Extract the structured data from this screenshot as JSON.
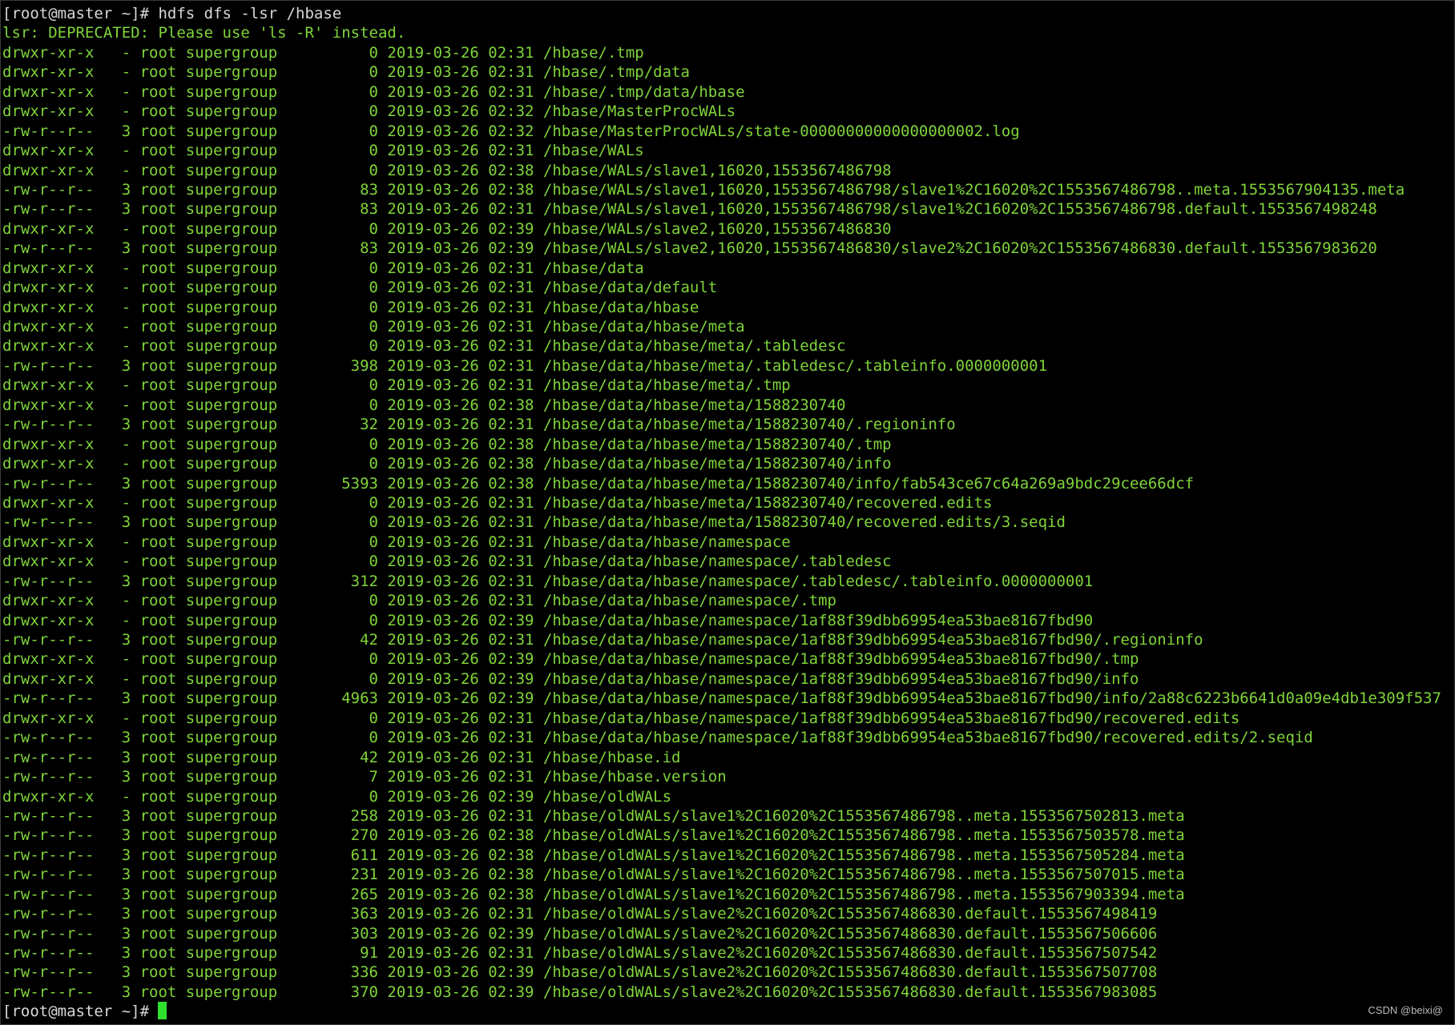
{
  "terminal": {
    "command_line": "[root@master ~]# hdfs dfs -lsr /hbase",
    "warning": "lsr: DEPRECATED: Please use 'ls -R' instead.",
    "listing": [
      "drwxr-xr-x   - root supergroup          0 2019-03-26 02:31 /hbase/.tmp",
      "drwxr-xr-x   - root supergroup          0 2019-03-26 02:31 /hbase/.tmp/data",
      "drwxr-xr-x   - root supergroup          0 2019-03-26 02:31 /hbase/.tmp/data/hbase",
      "drwxr-xr-x   - root supergroup          0 2019-03-26 02:32 /hbase/MasterProcWALs",
      "-rw-r--r--   3 root supergroup          0 2019-03-26 02:32 /hbase/MasterProcWALs/state-00000000000000000002.log",
      "drwxr-xr-x   - root supergroup          0 2019-03-26 02:31 /hbase/WALs",
      "drwxr-xr-x   - root supergroup          0 2019-03-26 02:38 /hbase/WALs/slave1,16020,1553567486798",
      "-rw-r--r--   3 root supergroup         83 2019-03-26 02:38 /hbase/WALs/slave1,16020,1553567486798/slave1%2C16020%2C1553567486798..meta.1553567904135.meta",
      "-rw-r--r--   3 root supergroup         83 2019-03-26 02:31 /hbase/WALs/slave1,16020,1553567486798/slave1%2C16020%2C1553567486798.default.1553567498248",
      "drwxr-xr-x   - root supergroup          0 2019-03-26 02:39 /hbase/WALs/slave2,16020,1553567486830",
      "-rw-r--r--   3 root supergroup         83 2019-03-26 02:39 /hbase/WALs/slave2,16020,1553567486830/slave2%2C16020%2C1553567486830.default.1553567983620",
      "drwxr-xr-x   - root supergroup          0 2019-03-26 02:31 /hbase/data",
      "drwxr-xr-x   - root supergroup          0 2019-03-26 02:31 /hbase/data/default",
      "drwxr-xr-x   - root supergroup          0 2019-03-26 02:31 /hbase/data/hbase",
      "drwxr-xr-x   - root supergroup          0 2019-03-26 02:31 /hbase/data/hbase/meta",
      "drwxr-xr-x   - root supergroup          0 2019-03-26 02:31 /hbase/data/hbase/meta/.tabledesc",
      "-rw-r--r--   3 root supergroup        398 2019-03-26 02:31 /hbase/data/hbase/meta/.tabledesc/.tableinfo.0000000001",
      "drwxr-xr-x   - root supergroup          0 2019-03-26 02:31 /hbase/data/hbase/meta/.tmp",
      "drwxr-xr-x   - root supergroup          0 2019-03-26 02:38 /hbase/data/hbase/meta/1588230740",
      "-rw-r--r--   3 root supergroup         32 2019-03-26 02:31 /hbase/data/hbase/meta/1588230740/.regioninfo",
      "drwxr-xr-x   - root supergroup          0 2019-03-26 02:38 /hbase/data/hbase/meta/1588230740/.tmp",
      "drwxr-xr-x   - root supergroup          0 2019-03-26 02:38 /hbase/data/hbase/meta/1588230740/info",
      "-rw-r--r--   3 root supergroup       5393 2019-03-26 02:38 /hbase/data/hbase/meta/1588230740/info/fab543ce67c64a269a9bdc29cee66dcf",
      "drwxr-xr-x   - root supergroup          0 2019-03-26 02:31 /hbase/data/hbase/meta/1588230740/recovered.edits",
      "-rw-r--r--   3 root supergroup          0 2019-03-26 02:31 /hbase/data/hbase/meta/1588230740/recovered.edits/3.seqid",
      "drwxr-xr-x   - root supergroup          0 2019-03-26 02:31 /hbase/data/hbase/namespace",
      "drwxr-xr-x   - root supergroup          0 2019-03-26 02:31 /hbase/data/hbase/namespace/.tabledesc",
      "-rw-r--r--   3 root supergroup        312 2019-03-26 02:31 /hbase/data/hbase/namespace/.tabledesc/.tableinfo.0000000001",
      "drwxr-xr-x   - root supergroup          0 2019-03-26 02:31 /hbase/data/hbase/namespace/.tmp",
      "drwxr-xr-x   - root supergroup          0 2019-03-26 02:39 /hbase/data/hbase/namespace/1af88f39dbb69954ea53bae8167fbd90",
      "-rw-r--r--   3 root supergroup         42 2019-03-26 02:31 /hbase/data/hbase/namespace/1af88f39dbb69954ea53bae8167fbd90/.regioninfo",
      "drwxr-xr-x   - root supergroup          0 2019-03-26 02:39 /hbase/data/hbase/namespace/1af88f39dbb69954ea53bae8167fbd90/.tmp",
      "drwxr-xr-x   - root supergroup          0 2019-03-26 02:39 /hbase/data/hbase/namespace/1af88f39dbb69954ea53bae8167fbd90/info",
      "-rw-r--r--   3 root supergroup       4963 2019-03-26 02:39 /hbase/data/hbase/namespace/1af88f39dbb69954ea53bae8167fbd90/info/2a88c6223b6641d0a09e4db1e309f537",
      "drwxr-xr-x   - root supergroup          0 2019-03-26 02:31 /hbase/data/hbase/namespace/1af88f39dbb69954ea53bae8167fbd90/recovered.edits",
      "-rw-r--r--   3 root supergroup          0 2019-03-26 02:31 /hbase/data/hbase/namespace/1af88f39dbb69954ea53bae8167fbd90/recovered.edits/2.seqid",
      "-rw-r--r--   3 root supergroup         42 2019-03-26 02:31 /hbase/hbase.id",
      "-rw-r--r--   3 root supergroup          7 2019-03-26 02:31 /hbase/hbase.version",
      "drwxr-xr-x   - root supergroup          0 2019-03-26 02:39 /hbase/oldWALs",
      "-rw-r--r--   3 root supergroup        258 2019-03-26 02:31 /hbase/oldWALs/slave1%2C16020%2C1553567486798..meta.1553567502813.meta",
      "-rw-r--r--   3 root supergroup        270 2019-03-26 02:38 /hbase/oldWALs/slave1%2C16020%2C1553567486798..meta.1553567503578.meta",
      "-rw-r--r--   3 root supergroup        611 2019-03-26 02:38 /hbase/oldWALs/slave1%2C16020%2C1553567486798..meta.1553567505284.meta",
      "-rw-r--r--   3 root supergroup        231 2019-03-26 02:38 /hbase/oldWALs/slave1%2C16020%2C1553567486798..meta.1553567507015.meta",
      "-rw-r--r--   3 root supergroup        265 2019-03-26 02:38 /hbase/oldWALs/slave1%2C16020%2C1553567486798..meta.1553567903394.meta",
      "-rw-r--r--   3 root supergroup        363 2019-03-26 02:31 /hbase/oldWALs/slave2%2C16020%2C1553567486830.default.1553567498419",
      "-rw-r--r--   3 root supergroup        303 2019-03-26 02:39 /hbase/oldWALs/slave2%2C16020%2C1553567486830.default.1553567506606",
      "-rw-r--r--   3 root supergroup         91 2019-03-26 02:31 /hbase/oldWALs/slave2%2C16020%2C1553567486830.default.1553567507542",
      "-rw-r--r--   3 root supergroup        336 2019-03-26 02:39 /hbase/oldWALs/slave2%2C16020%2C1553567486830.default.1553567507708",
      "-rw-r--r--   3 root supergroup        370 2019-03-26 02:39 /hbase/oldWALs/slave2%2C16020%2C1553567486830.default.1553567983085"
    ],
    "final_prompt": "[root@master ~]# "
  },
  "watermark": "CSDN @beixi@",
  "colors": {
    "background": "#000000",
    "listing_text": "#7fd43a",
    "prompt_text": "#d8d8d8",
    "cursor": "#2fe02f"
  }
}
